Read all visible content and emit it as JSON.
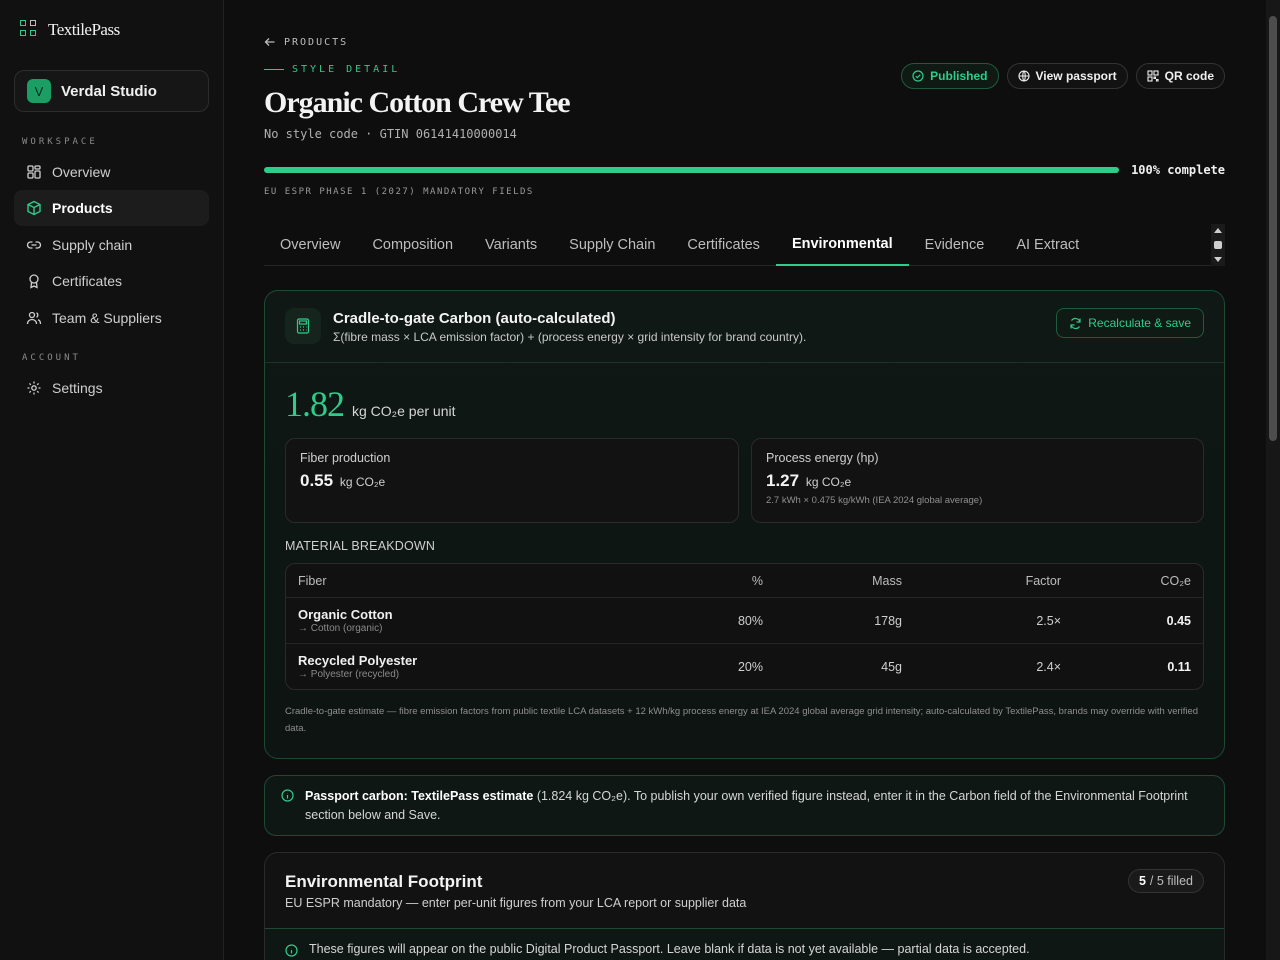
{
  "sidebar": {
    "brand": "TextilePass",
    "workspace": {
      "initial": "V",
      "name": "Verdal Studio"
    },
    "workspace_section": "WORKSPACE",
    "account_section": "ACCOUNT",
    "items": [
      {
        "label": "Overview",
        "icon": "grid-icon"
      },
      {
        "label": "Products",
        "icon": "box-icon",
        "active": true
      },
      {
        "label": "Supply chain",
        "icon": "link-icon"
      },
      {
        "label": "Certificates",
        "icon": "award-icon"
      },
      {
        "label": "Team & Suppliers",
        "icon": "users-icon"
      }
    ],
    "settings": {
      "label": "Settings",
      "icon": "gear-icon"
    }
  },
  "header": {
    "back_label": "PRODUCTS",
    "kicker": "STYLE DETAIL",
    "title": "Organic Cotton Crew Tee",
    "subtitle": "No style code · GTIN 06141410000014",
    "actions": {
      "published": "Published",
      "view_passport": "View passport",
      "qr_code": "QR code"
    },
    "progress": {
      "percent": 100,
      "label": "100% complete"
    },
    "espr_label": "EU ESPR PHASE 1 (2027) MANDATORY FIELDS"
  },
  "tabs": [
    {
      "label": "Overview"
    },
    {
      "label": "Composition"
    },
    {
      "label": "Variants"
    },
    {
      "label": "Supply Chain"
    },
    {
      "label": "Certificates"
    },
    {
      "label": "Environmental",
      "active": true
    },
    {
      "label": "Evidence"
    },
    {
      "label": "AI Extract"
    }
  ],
  "carbon": {
    "title": "Cradle-to-gate Carbon (auto-calculated)",
    "formula": "Σ(fibre mass × LCA emission factor) + (process energy × grid intensity for brand country).",
    "recalc_label": "Recalculate & save",
    "total_value": "1.82",
    "total_unit": "kg CO₂e per unit",
    "fiber": {
      "label": "Fiber production",
      "value": "0.55",
      "unit": "kg CO₂e"
    },
    "process": {
      "label": "Process energy (hp)",
      "value": "1.27",
      "unit": "kg CO₂e",
      "note": "2.7 kWh × 0.475 kg/kWh (IEA 2024 global average)"
    },
    "breakdown_title": "MATERIAL BREAKDOWN",
    "columns": {
      "fiber": "Fiber",
      "pct": "%",
      "mass": "Mass",
      "factor": "Factor",
      "co2": "CO₂e"
    },
    "rows": [
      {
        "name": "Organic Cotton",
        "sub": "→ Cotton (organic)",
        "pct": "80%",
        "mass": "178g",
        "factor": "2.5×",
        "co2": "0.45"
      },
      {
        "name": "Recycled Polyester",
        "sub": "→ Polyester (recycled)",
        "pct": "20%",
        "mass": "45g",
        "factor": "2.4×",
        "co2": "0.11"
      }
    ],
    "footnote": "Cradle-to-gate estimate — fibre emission factors from public textile LCA datasets + 12 kWh/kg process energy at IEA 2024 global average grid intensity; auto-calculated by TextilePass, brands may override with verified data."
  },
  "banner": {
    "bold": "Passport carbon: TextilePass estimate",
    "text": " (1.824 kg CO₂e). To publish your own verified figure instead, enter it in the Carbon field of the Environmental Footprint section below and Save."
  },
  "footprint": {
    "title": "Environmental Footprint",
    "subtitle": "EU ESPR mandatory — enter per-unit figures from your LCA report or supplier data",
    "filled_count": "5",
    "filled_label": "/ 5 filled",
    "note": "These figures will appear on the public Digital Product Passport. Leave blank if data is not yet available — partial data is accepted."
  },
  "colors": {
    "accent": "#2ecc8a",
    "background": "#0e0e0e"
  }
}
